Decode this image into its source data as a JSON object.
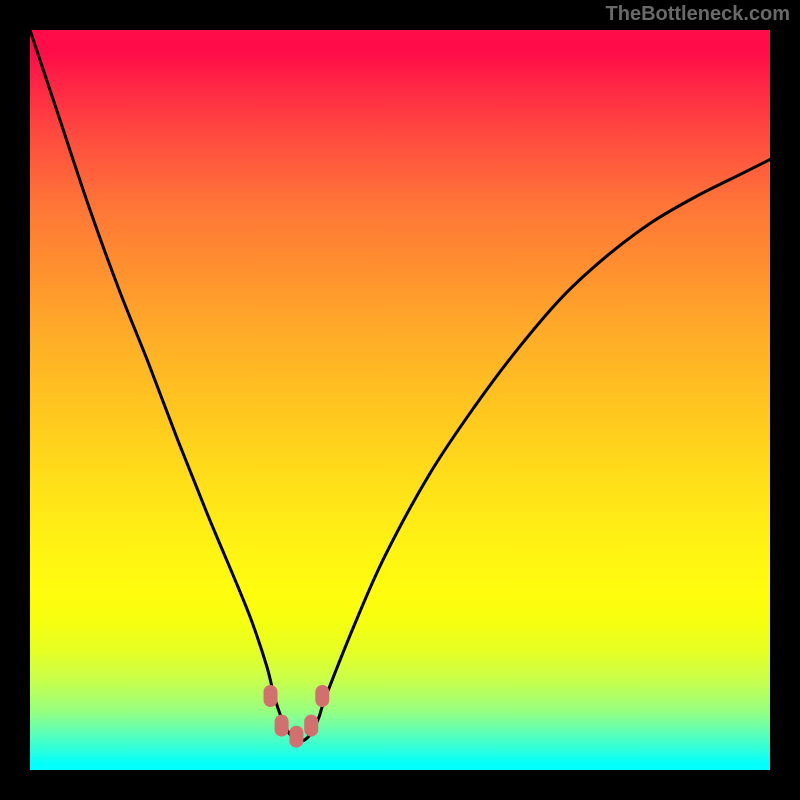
{
  "attribution": "TheBottleneck.com",
  "chart_data": {
    "type": "line",
    "title": "",
    "xlabel": "",
    "ylabel": "",
    "xlim": [
      0,
      100
    ],
    "ylim": [
      0,
      100
    ],
    "x": [
      0,
      4,
      8,
      12,
      16,
      20,
      24,
      28,
      30,
      32,
      33,
      34,
      35,
      36,
      37,
      38,
      39,
      40,
      44,
      48,
      54,
      60,
      66,
      72,
      78,
      84,
      90,
      96,
      100
    ],
    "values": [
      100,
      88,
      76,
      65,
      55,
      44.5,
      34.5,
      25,
      20,
      14,
      10,
      7,
      5,
      4,
      4,
      5,
      7,
      10,
      20,
      29,
      40,
      49,
      57,
      64,
      69.5,
      74,
      77.5,
      80.5,
      82.5
    ],
    "gradient_scale": {
      "description": "Background heat gradient, green=good (bottom), red=bad (top)",
      "stops": [
        {
          "pos": 0,
          "color": "#ff0c49"
        },
        {
          "pos": 25,
          "color": "#ff7c35"
        },
        {
          "pos": 50,
          "color": "#ffc620"
        },
        {
          "pos": 75,
          "color": "#fffb10"
        },
        {
          "pos": 90,
          "color": "#b0ff66"
        },
        {
          "pos": 100,
          "color": "#00ffff"
        }
      ]
    },
    "markers": [
      {
        "x": 32.5,
        "y": 10,
        "label": "",
        "color": "#d27070"
      },
      {
        "x": 34,
        "y": 6,
        "label": "",
        "color": "#d27070"
      },
      {
        "x": 36,
        "y": 4.5,
        "label": "",
        "color": "#d27070"
      },
      {
        "x": 38,
        "y": 6,
        "label": "",
        "color": "#d27070"
      },
      {
        "x": 39.5,
        "y": 10,
        "label": "",
        "color": "#d27070"
      }
    ]
  },
  "colors": {
    "frame": "#000000",
    "curve": "#000000",
    "marker": "#d27070",
    "attribution": "#696969"
  }
}
